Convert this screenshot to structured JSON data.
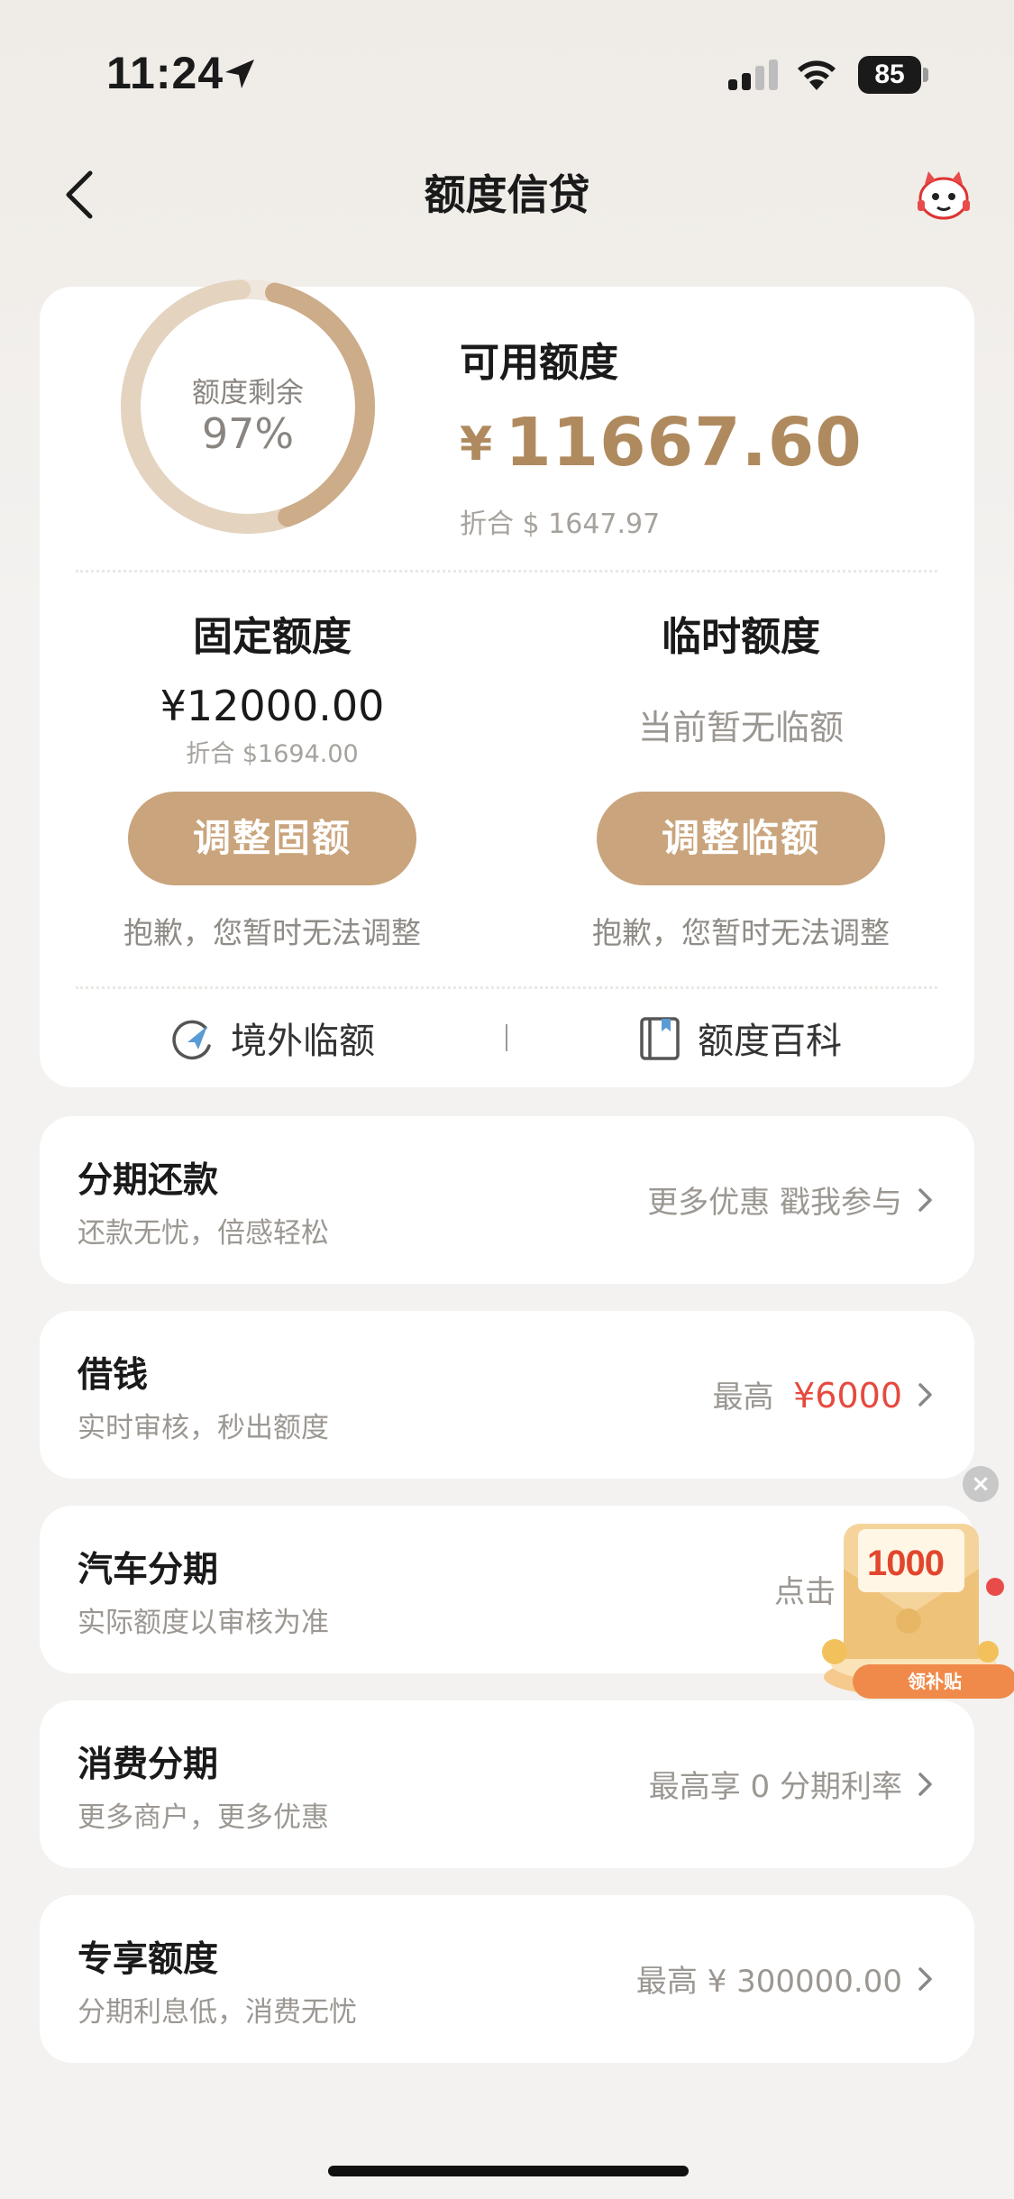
{
  "status_bar": {
    "time": "11:24",
    "battery": "85"
  },
  "header": {
    "title": "额度信贷"
  },
  "summary": {
    "ring_label": "额度剩余",
    "ring_percent_text": "97%",
    "ring_fraction": 0.97,
    "available_label": "可用额度",
    "available_currency": "¥",
    "available_amount": "11667.60",
    "available_usd": "折合 $ 1647.97"
  },
  "fixed": {
    "title": "固定额度",
    "amount": "¥12000.00",
    "usd": "折合 $1694.00",
    "button": "调整固额",
    "note": "抱歉，您暂时无法调整"
  },
  "temporary": {
    "title": "临时额度",
    "status": "当前暂无临额",
    "button": "调整临额",
    "note": "抱歉，您暂时无法调整"
  },
  "links": {
    "overseas": "境外临额",
    "divider": "|",
    "wiki": "额度百科"
  },
  "rows": [
    {
      "title": "分期还款",
      "subtitle": "还款无忧，倍感轻松",
      "right": "更多优惠 戳我参与"
    },
    {
      "title": "借钱",
      "subtitle": "实时审核，秒出额度",
      "right_prefix": "最高",
      "right_highlight": "¥6000"
    },
    {
      "title": "汽车分期",
      "subtitle": "实际额度以审核为准",
      "right": "点击"
    },
    {
      "title": "消费分期",
      "subtitle": "更多商户，更多优惠",
      "right": "最高享 0 分期利率"
    },
    {
      "title": "专享额度",
      "subtitle": "分期利息低，消费无忧",
      "right": "最高 ¥ 300000.00"
    }
  ],
  "promo": {
    "amount": "1000",
    "tag": "领补贴",
    "close": "×"
  },
  "colors": {
    "accent": "#b08a5f",
    "button": "#c9a47c",
    "highlight": "#e64a3e"
  }
}
